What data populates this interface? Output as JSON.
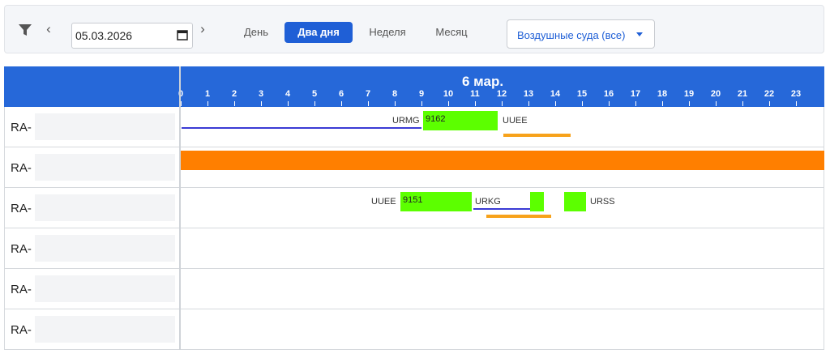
{
  "toolbar": {
    "prev_label": "‹",
    "next_label": "›",
    "date_value": "05.03.2026",
    "tabs": [
      {
        "label": "День",
        "active": false
      },
      {
        "label": "Два дня",
        "active": true
      },
      {
        "label": "Неделя",
        "active": false
      },
      {
        "label": "Месяц",
        "active": false
      }
    ],
    "aircraft_filter": "Воздушные суда (все)"
  },
  "timeline": {
    "day_label": "6 мар.",
    "hours": [
      "0",
      "1",
      "2",
      "3",
      "4",
      "5",
      "6",
      "7",
      "8",
      "9",
      "10",
      "11",
      "12",
      "13",
      "14",
      "15",
      "16",
      "17",
      "18",
      "19",
      "20",
      "21",
      "22",
      "23"
    ]
  },
  "rows": [
    {
      "label": "RA-"
    },
    {
      "label": "RA-"
    },
    {
      "label": "RA-"
    },
    {
      "label": "RA-"
    },
    {
      "label": "RA-"
    },
    {
      "label": "RA-"
    }
  ],
  "flights": {
    "row1": {
      "origin": "URMG",
      "number": "9162",
      "destination": "UUEE"
    },
    "row3": {
      "origin": "UUEE",
      "number": "9151",
      "middle": "URKG",
      "destination": "URSS"
    }
  },
  "colors": {
    "accent": "#1f5fd6",
    "header": "#2668d9",
    "flight": "#5cff00",
    "maintenance": "#ff7f00",
    "ground": "#f7a21b",
    "link": "#3a3ad4"
  }
}
